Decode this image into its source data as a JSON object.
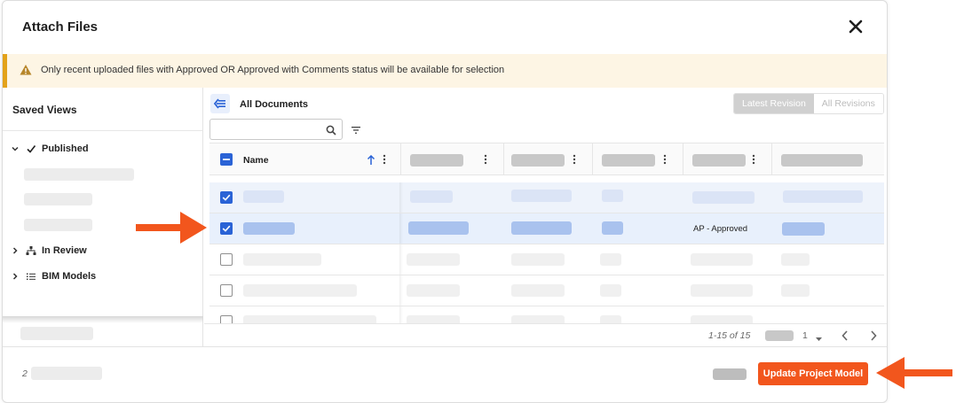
{
  "dialog": {
    "title": "Attach Files",
    "close_icon": "close-icon"
  },
  "banner": {
    "icon": "warning-icon",
    "text": "Only recent uploaded files with Approved OR Approved with Comments status will be available for selection",
    "accent_color": "#e3a21a"
  },
  "sidebar": {
    "title": "Saved Views",
    "tree": [
      {
        "label": "Published",
        "expanded": true,
        "icon": "checkmark-icon"
      },
      {
        "label": "In Review",
        "expanded": false,
        "icon": "hierarchy-icon"
      },
      {
        "label": "BIM Models",
        "expanded": false,
        "icon": "list-icon"
      }
    ]
  },
  "main": {
    "breadcrumb": "All Documents",
    "back_icon": "collapse-left-icon",
    "revision_toggle": {
      "options": [
        "Latest Revision",
        "All Revisions"
      ],
      "selected": "Latest Revision"
    },
    "search": {
      "value": "",
      "placeholder": ""
    },
    "table": {
      "name_header": "Name",
      "sort": "ascending",
      "status_cell_text": "AP - Approved"
    },
    "pager": {
      "count_text": "1-15 of 15",
      "page": "1"
    }
  },
  "footer": {
    "selected_count": "2",
    "primary_button": "Update Project Model",
    "accent_color": "#f2561d"
  },
  "annotations": {
    "arrow_color": "#f2561d"
  }
}
